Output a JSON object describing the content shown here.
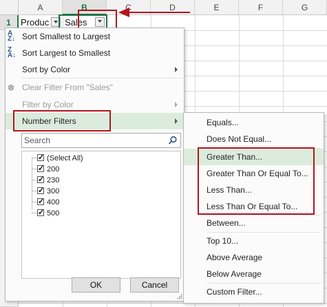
{
  "grid": {
    "columns": [
      "A",
      "B",
      "C",
      "D",
      "E",
      "F",
      "G"
    ],
    "rows": [
      "1"
    ],
    "cells": {
      "a1": "Produc",
      "b1": "Sales"
    }
  },
  "menu": {
    "sort_asc": "Sort Smallest to Largest",
    "sort_desc": "Sort Largest to Smallest",
    "sort_color": "Sort by Color",
    "clear_filter": "Clear Filter From \"Sales\"",
    "filter_color": "Filter by Color",
    "number_filters": "Number Filters",
    "search_placeholder": "Search",
    "list_items": [
      "(Select All)",
      "200",
      "230",
      "300",
      "400",
      "500"
    ],
    "ok": "OK",
    "cancel": "Cancel"
  },
  "submenu": {
    "items": [
      "Equals...",
      "Does Not Equal...",
      "Greater Than...",
      "Greater Than Or Equal To...",
      "Less Than...",
      "Less Than Or Equal To...",
      "Between...",
      "Top 10...",
      "Above Average",
      "Below Average",
      "Custom Filter..."
    ]
  },
  "colors": {
    "highlight": "#dcecdc",
    "annotation_red": "#b3141d",
    "excel_green": "#217346"
  }
}
